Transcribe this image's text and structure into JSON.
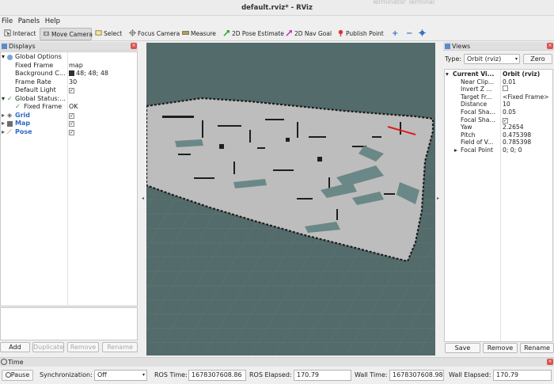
{
  "window": {
    "title": "default.rviz* - RViz",
    "ghost_text": "Terminator Terminal"
  },
  "menu": [
    {
      "label": "File",
      "u": "F"
    },
    {
      "label": "Panels",
      "u": "P"
    },
    {
      "label": "Help",
      "u": "H"
    }
  ],
  "toolbar": {
    "interact": "Interact",
    "move_camera": "Move Camera",
    "select": "Select",
    "focus_camera": "Focus Camera",
    "measure": "Measure",
    "pose_estimate": "2D Pose Estimate",
    "nav_goal": "2D Nav Goal",
    "publish_point": "Publish Point"
  },
  "displays": {
    "title": "Displays",
    "rows": [
      {
        "label": "Global Options",
        "value": ""
      },
      {
        "label": "Fixed Frame",
        "value": "map"
      },
      {
        "label": "Background C...",
        "value": "48; 48; 48"
      },
      {
        "label": "Frame Rate",
        "value": "30"
      },
      {
        "label": "Default Light",
        "value": "✓"
      },
      {
        "label": "Global Status:...",
        "value": ""
      },
      {
        "label": "Fixed Frame",
        "value": "OK"
      },
      {
        "label": "Grid",
        "value": "✓"
      },
      {
        "label": "Map",
        "value": "✓"
      },
      {
        "label": "Pose",
        "value": "✓"
      }
    ],
    "buttons": {
      "add": "Add",
      "duplicate": "Duplicate",
      "remove": "Remove",
      "rename": "Rename"
    }
  },
  "views": {
    "title": "Views",
    "type_label": "Type:",
    "type_value": "Orbit (rviz)",
    "zero": "Zero",
    "rows": [
      {
        "label": "Current Vi...",
        "value": "Orbit (rviz)"
      },
      {
        "label": "Near Clip...",
        "value": "0.01"
      },
      {
        "label": "Invert Z ...",
        "value": ""
      },
      {
        "label": "Target Fr...",
        "value": "<Fixed Frame>"
      },
      {
        "label": "Distance",
        "value": "10"
      },
      {
        "label": "Focal Sha...",
        "value": "0.05"
      },
      {
        "label": "Focal Sha...",
        "value": "✓"
      },
      {
        "label": "Yaw",
        "value": "2.2654"
      },
      {
        "label": "Pitch",
        "value": "0.475398"
      },
      {
        "label": "Field of V...",
        "value": "0.785398"
      },
      {
        "label": "Focal Point",
        "value": "0; 0; 0"
      }
    ],
    "buttons": {
      "save": "Save",
      "remove": "Remove",
      "rename": "Rename"
    }
  },
  "time": {
    "title": "Time",
    "pause": "Pause",
    "sync_label": "Synchronization:",
    "sync_value": "Off",
    "ros_time_label": "ROS Time:",
    "ros_time": "1678307608.86",
    "ros_elapsed_label": "ROS Elapsed:",
    "ros_elapsed": "170.79",
    "wall_time_label": "Wall Time:",
    "wall_time": "1678307608.98",
    "wall_elapsed_label": "Wall Elapsed:",
    "wall_elapsed": "170.79"
  },
  "colors": {
    "background": "#303030",
    "viewport_bg": "#536b6a",
    "map_free": "#bdbdbd",
    "pose_arrow": "#e01b1b",
    "display_link": "#2a6bc4"
  }
}
